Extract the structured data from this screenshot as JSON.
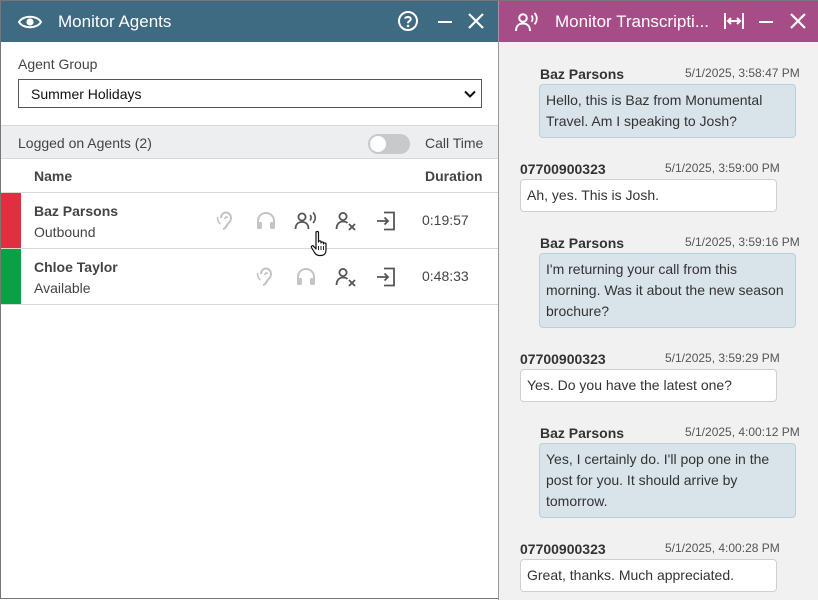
{
  "left": {
    "title": "Monitor Agents",
    "icons": {
      "title_icon": "eye-icon",
      "help": "help-icon",
      "minimize": "minimize-icon",
      "close": "close-icon"
    },
    "agent_group_label": "Agent Group",
    "agent_group_value": "Summer Holidays",
    "logged_label": "Logged on Agents (2)",
    "call_time_label": "Call Time",
    "call_time_on": false,
    "columns": {
      "name": "Name",
      "duration": "Duration"
    },
    "agents": [
      {
        "name": "Baz Parsons",
        "status": "Outbound",
        "duration": "0:19:57",
        "status_color": "#e0303f"
      },
      {
        "name": "Chloe Taylor",
        "status": "Available",
        "duration": "0:48:33",
        "status_color": "#0aa043"
      }
    ]
  },
  "right": {
    "title": "Monitor Transcripti...",
    "icons": {
      "title_icon": "transcription-icon",
      "expand": "expand-horizontal-icon",
      "minimize": "minimize-icon",
      "close": "close-icon"
    },
    "messages": [
      {
        "speaker": "Baz Parsons",
        "time": "5/1/2025, 3:58:47 PM",
        "text": "Hello, this is Baz from Monumental Travel. Am I speaking to Josh?",
        "type": "agent"
      },
      {
        "speaker": "07700900323",
        "time": "5/1/2025, 3:59:00 PM",
        "text": "Ah, yes. This is Josh.",
        "type": "customer"
      },
      {
        "speaker": "Baz Parsons",
        "time": "5/1/2025, 3:59:16 PM",
        "text": "I'm returning your call from this morning. Was it about the new season brochure?",
        "type": "agent"
      },
      {
        "speaker": "07700900323",
        "time": "5/1/2025, 3:59:29 PM",
        "text": "Yes. Do you have the latest one?",
        "type": "customer"
      },
      {
        "speaker": "Baz Parsons",
        "time": "5/1/2025, 4:00:12 PM",
        "text": "Yes, I certainly do. I'll pop one in the post for you. It should arrive by tomorrow.",
        "type": "agent"
      },
      {
        "speaker": "07700900323",
        "time": "5/1/2025, 4:00:28 PM",
        "text": "Great, thanks. Much appreciated.",
        "type": "customer"
      }
    ]
  }
}
